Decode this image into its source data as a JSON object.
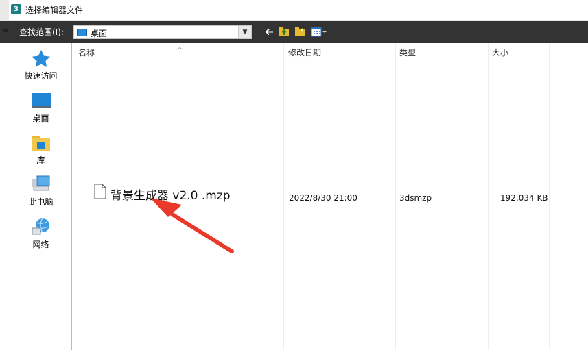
{
  "window": {
    "title": "选择编辑器文件",
    "app_icon_glyph": "3"
  },
  "toolbar": {
    "look_in_label": "查找范围(I):",
    "location": "桌面",
    "icons": [
      "back-arrow-icon",
      "up-folder-icon",
      "new-folder-icon",
      "view-menu-icon"
    ]
  },
  "sidebar": {
    "items": [
      {
        "label": "快速访问",
        "icon": "star-icon"
      },
      {
        "label": "桌面",
        "icon": "desktop-icon"
      },
      {
        "label": "库",
        "icon": "library-icon"
      },
      {
        "label": "此电脑",
        "icon": "computer-icon"
      },
      {
        "label": "网络",
        "icon": "network-icon"
      }
    ]
  },
  "columns": {
    "name": "名称",
    "modified": "修改日期",
    "type": "类型",
    "size": "大小"
  },
  "files": [
    {
      "name": "背景生成器 v2.0 .mzp",
      "modified": "2022/8/30 21:00",
      "type": "3dsmzp",
      "size": "192,034 KB"
    }
  ],
  "colors": {
    "toolbar_bg": "#333333",
    "accent": "#2a8bd8",
    "annotation_arrow": "#e8392a"
  }
}
